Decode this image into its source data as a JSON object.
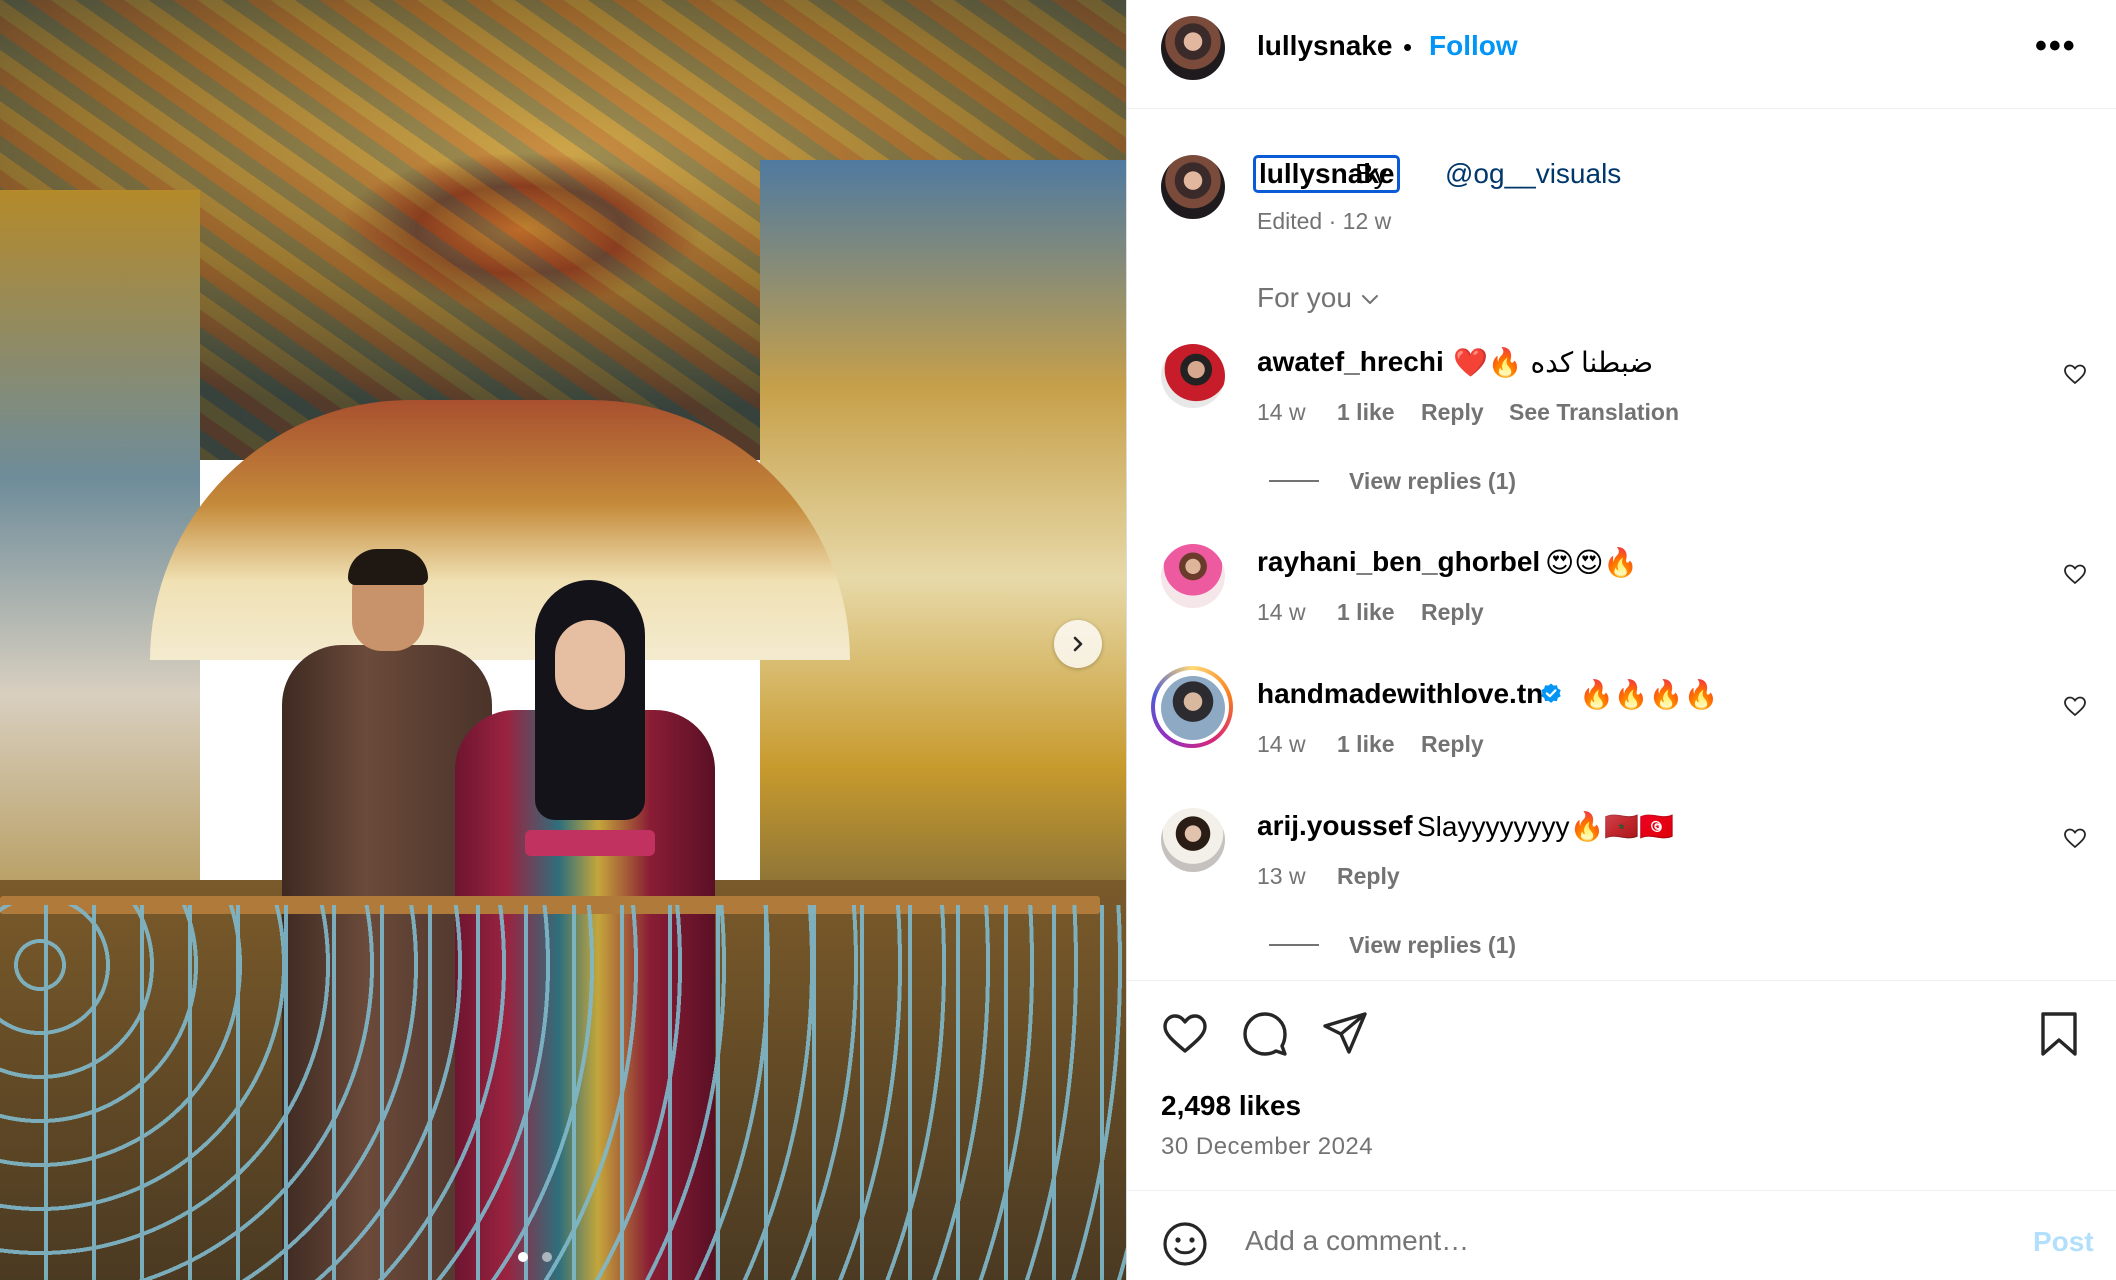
{
  "post": {
    "author": "lullysnake",
    "separator": "•",
    "follow_label": "Follow",
    "more_label": "•••",
    "caption": {
      "username": "lullysnake",
      "by": "By",
      "mention": "@og__visuals",
      "meta": "Edited · 12 w"
    },
    "sort_label": "For you",
    "likes": "2,498 likes",
    "date": "30 December 2024",
    "add_comment_placeholder": "Add a comment…",
    "post_label": "Post"
  },
  "comments": [
    {
      "username": "awatef_hrechi",
      "text": "❤️🔥 ضبطنا كده",
      "time": "14 w",
      "likes": "1 like",
      "reply": "Reply",
      "translation": "See Translation",
      "view_replies": "View replies (1)"
    },
    {
      "username": "rayhani_ben_ghorbel",
      "text": "😍😍🔥",
      "time": "14 w",
      "likes": "1 like",
      "reply": "Reply"
    },
    {
      "username": "handmadewithlove.tn",
      "text": "🔥🔥🔥🔥",
      "time": "14 w",
      "likes": "1 like",
      "reply": "Reply"
    },
    {
      "username": "arij.youssef",
      "text": "Slayyyyyyyy🔥🇲🇦🇹🇳",
      "time": "13 w",
      "reply": "Reply",
      "view_replies": "View replies (1)"
    }
  ],
  "icons": {
    "next": "chevron-right-icon",
    "sort": "chevron-down-icon",
    "like": "heart-icon",
    "comment": "comment-icon",
    "share": "send-icon",
    "save": "bookmark-icon",
    "emoji": "emoji-icon",
    "verified": "verified-badge-icon"
  },
  "colors": {
    "accent": "#0095f6",
    "muted": "#737373",
    "mention": "#00376b",
    "post_disabled": "#b2dffc"
  }
}
